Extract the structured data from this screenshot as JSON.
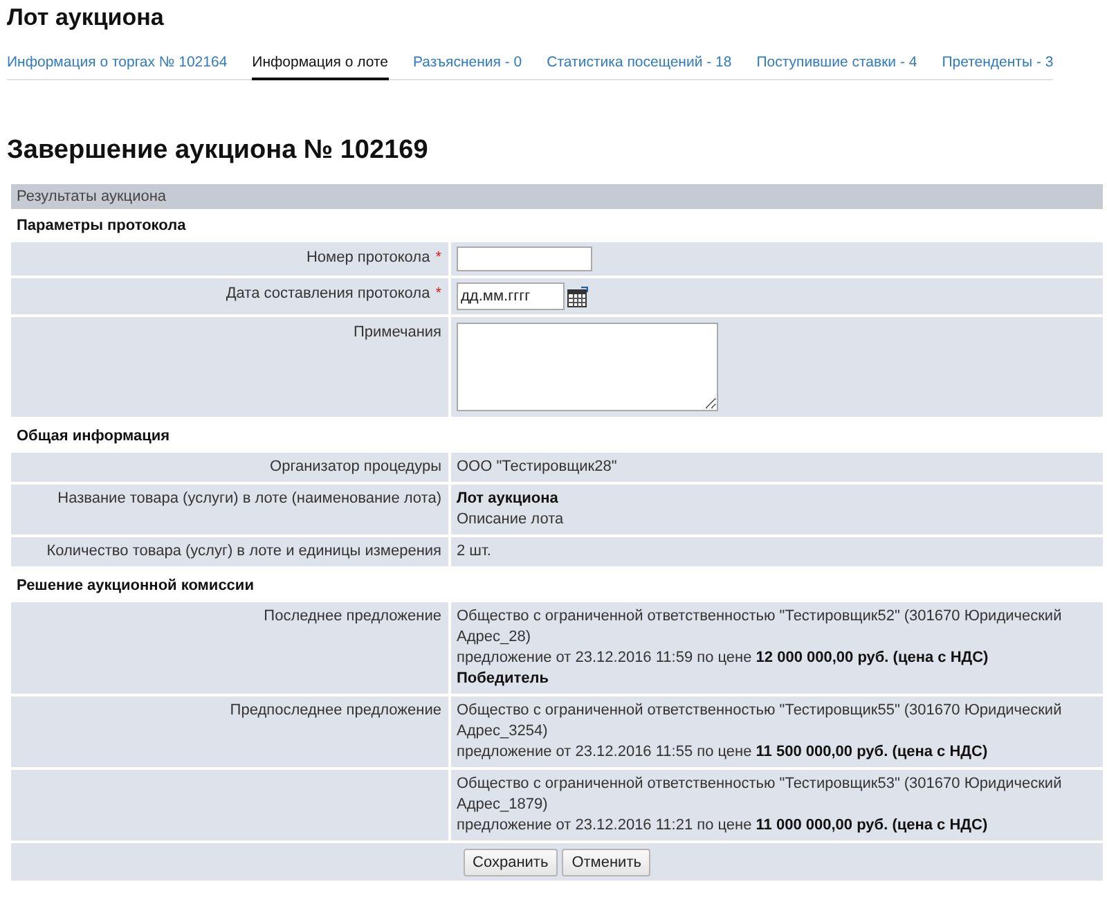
{
  "page": {
    "title": "Лот аукциона"
  },
  "tabs": [
    {
      "label": "Информация о торгах № 102164",
      "selected": false
    },
    {
      "label": "Информация о лоте",
      "selected": true
    },
    {
      "label": "Разъяснения - 0",
      "selected": false
    },
    {
      "label": "Статистика посещений - 18",
      "selected": false
    },
    {
      "label": "Поступившие ставки - 4",
      "selected": false
    },
    {
      "label": "Претенденты - 3",
      "selected": false
    }
  ],
  "heading": "Завершение аукциона № 102169",
  "panel": {
    "title": "Результаты аукциона",
    "sections": [
      {
        "title": "Параметры протокола",
        "rows": [
          {
            "kind": "input",
            "label": "Номер протокола",
            "required_mark": "*"
          },
          {
            "kind": "date",
            "label": "Дата составления протокола",
            "required_mark": "*",
            "placeholder": "дд.мм.гггг"
          },
          {
            "kind": "textarea",
            "label": "Примечания"
          }
        ]
      },
      {
        "title": "Общая информация",
        "rows": [
          {
            "kind": "text",
            "label": "Организатор процедуры",
            "lines": [
              {
                "text": "ООО \"Тестировщик28\"",
                "bold": false
              }
            ]
          },
          {
            "kind": "text",
            "label": "Название товара (услуги) в лоте (наименование лота)",
            "lines": [
              {
                "text": "Лот аукциона",
                "bold": true
              },
              {
                "text": "Описание лота",
                "bold": false
              }
            ]
          },
          {
            "kind": "text",
            "label": "Количество товара (услуг) в лоте и единицы измерения",
            "lines": [
              {
                "text": "2 шт.",
                "bold": false
              }
            ]
          }
        ]
      },
      {
        "title": "Решение аукционной комиссии",
        "rows": [
          {
            "kind": "bid",
            "label": "Последнее предложение",
            "bidder": "Общество с ограниченной ответственностью \"Тестировщик52\" (301670 Юридический Адрес_28)",
            "offer": "предложение от 23.12.2016 11:59 по цене **12 000 000,00 руб. (цена с НДС)**",
            "result": "Победитель"
          },
          {
            "kind": "bid",
            "label": "Предпоследнее предложение",
            "bidder": "Общество с ограниченной ответственностью \"Тестировщик55\" (301670 Юридический Адрес_3254)",
            "offer": "предложение от 23.12.2016 11:55 по цене **11 500 000,00 руб. (цена с НДС)**"
          },
          {
            "kind": "bid",
            "bidder": "Общество с ограниченной ответственностью \"Тестировщик53\" (301670 Юридический Адрес_1879)",
            "offer": "предложение от 23.12.2016 11:21 по цене **11 000 000,00 руб. (цена с НДС)**"
          }
        ]
      }
    ],
    "buttons": [
      "Сохранить",
      "Отменить"
    ]
  }
}
